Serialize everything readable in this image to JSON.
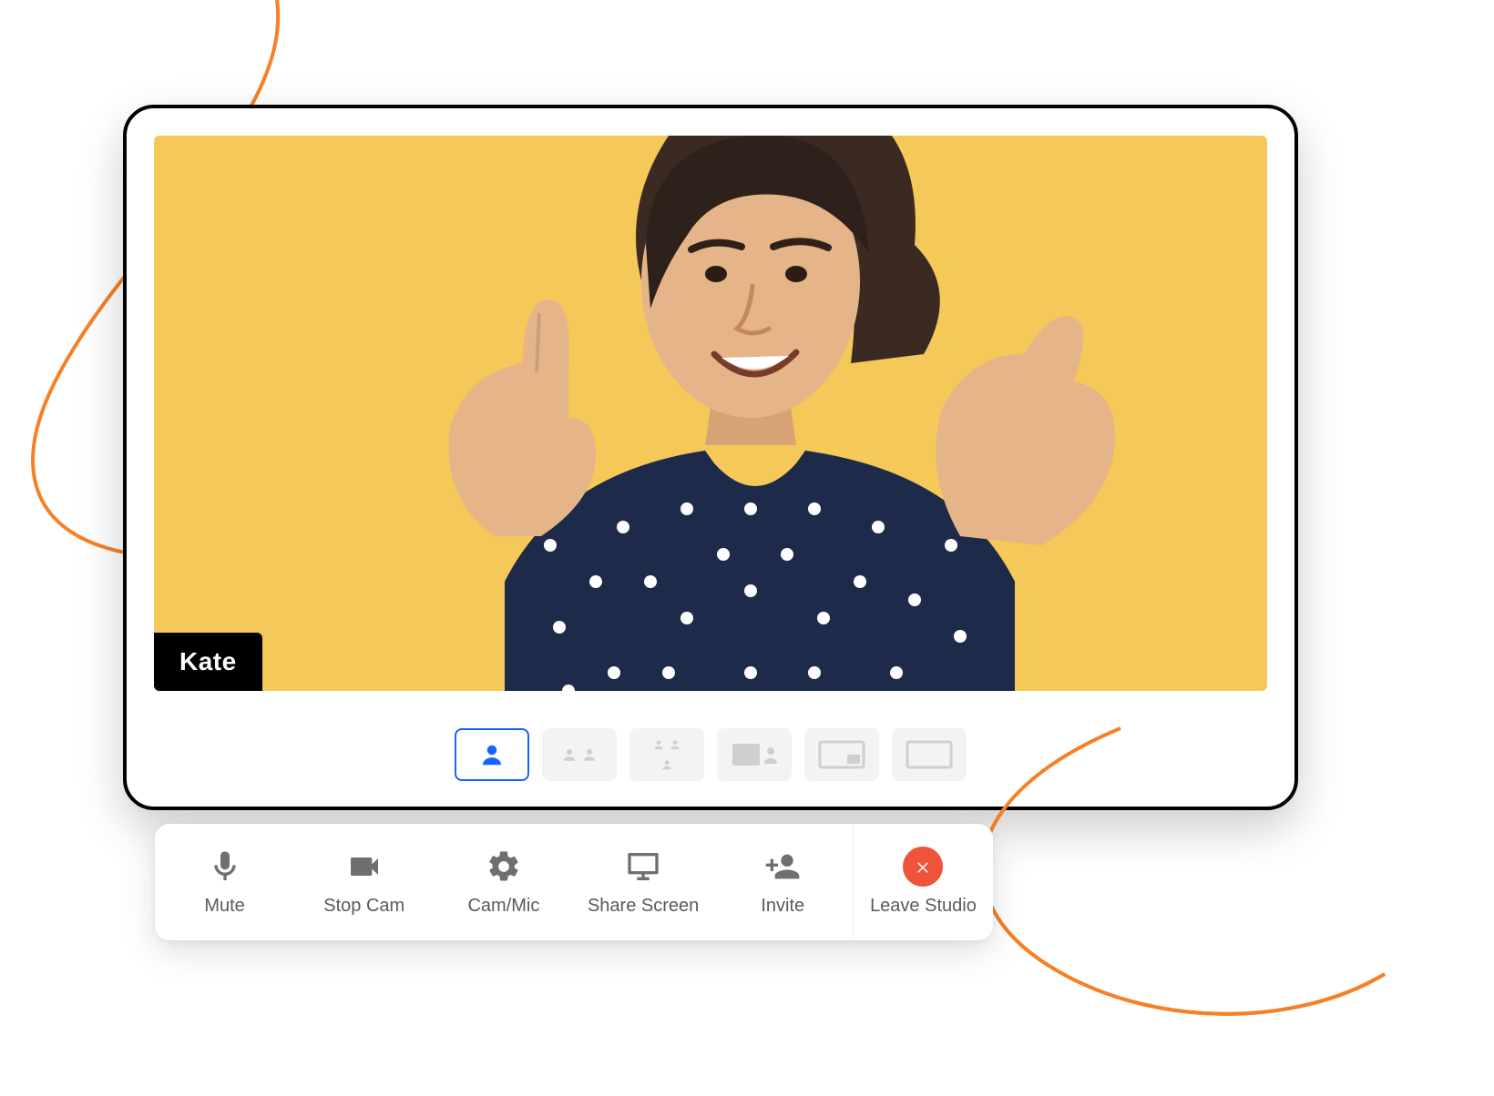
{
  "participant": {
    "name": "Kate"
  },
  "layouts": [
    {
      "id": "single",
      "active": true
    },
    {
      "id": "two-up",
      "active": false
    },
    {
      "id": "three-up",
      "active": false
    },
    {
      "id": "four-up",
      "active": false
    },
    {
      "id": "pip-right",
      "active": false
    },
    {
      "id": "full-screen",
      "active": false
    }
  ],
  "toolbar": {
    "mute_label": "Mute",
    "stop_cam_label": "Stop Cam",
    "cam_mic_label": "Cam/Mic",
    "share_screen_label": "Share Screen",
    "invite_label": "Invite",
    "leave_label": "Leave Studio"
  },
  "colors": {
    "video_background": "#f5c85a",
    "accent_blue": "#1565ff",
    "leave_red": "#ef533a",
    "swoosh_orange": "#f58025"
  }
}
